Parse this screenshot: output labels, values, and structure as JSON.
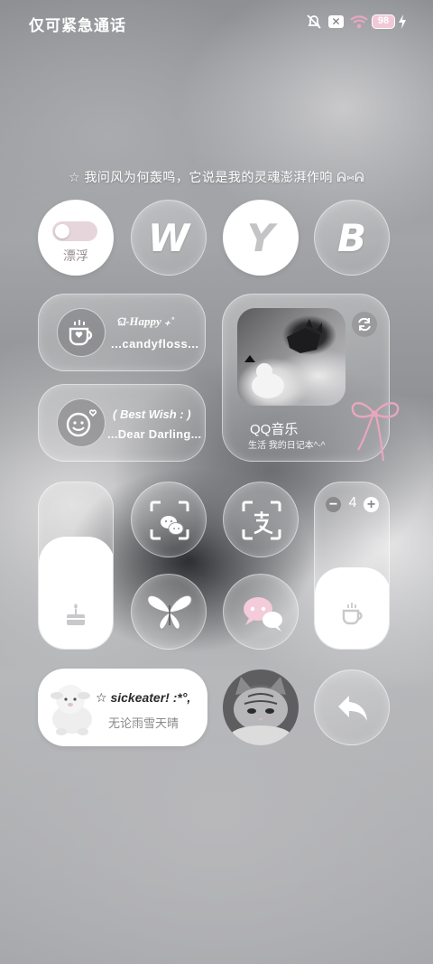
{
  "status_bar": {
    "left_text": "仅可紧急通话",
    "battery": "98",
    "icons": [
      "bell-off-icon",
      "sim-x-icon",
      "wifi-icon",
      "battery-icon",
      "charging-icon"
    ]
  },
  "quote": "☆ 我问风为何轰鸣，它说是我的灵魂澎湃作响 ᕱ⑅ᕱ",
  "toggle": {
    "label": "漂浮"
  },
  "letters": [
    "W",
    "Y",
    "B"
  ],
  "widget_happy": {
    "line1": "ଘ-Happy ₊˚",
    "line2": "...candyfloss..."
  },
  "widget_wish": {
    "line1": "( Best  Wish : )",
    "line2": "...Dear Darling..."
  },
  "music": {
    "title": "QQ音乐",
    "subtitle": "生活 我的日记本^-^"
  },
  "scan_wechat": {
    "icon": "wechat-scan-icon"
  },
  "scan_alipay": {
    "icon": "alipay-scan-icon"
  },
  "stepper": {
    "minus": "−",
    "value": "4",
    "plus": "+"
  },
  "profile": {
    "name": "☆ sickeater! :*°,",
    "subtitle": "无论雨雪天晴"
  },
  "colors": {
    "accent_pink": "#e8a6bd",
    "glass_border": "#ffffff"
  }
}
